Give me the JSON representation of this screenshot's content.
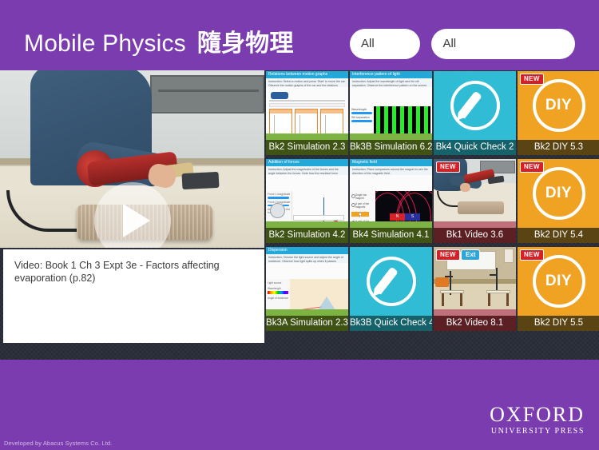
{
  "theme": {
    "brand_purple": "#7B3CAF",
    "canvas_dark": "#2b2f3a",
    "label_green": "#3f5314",
    "label_teal": "#15626b",
    "label_brown": "#5a4413",
    "label_maroon": "#5c2024",
    "badge_new_red": "#d81f26",
    "badge_ext_blue": "#2fa5d8",
    "tile_quickcheck": "#2fbcd4",
    "tile_diy": "#f0a322"
  },
  "header": {
    "title_en": "Mobile Physics",
    "title_zh": "隨身物理",
    "filters": [
      {
        "name": "book-filter",
        "value": "All"
      },
      {
        "name": "type-filter",
        "value": "All"
      }
    ]
  },
  "video_player": {
    "play_icon": "play-triangle-icon",
    "caption": "Video: Book 1 Ch 3 Expt 3e - Factors affecting evaporation (p.82)"
  },
  "tiles": [
    {
      "label": "Bk2 Simulation 2.3",
      "kind": "simulation",
      "label_color": "green",
      "badges": [],
      "sim_title": "Relations between motion graphs",
      "sim_instruction": "Instruction: Select a motion and press 'Start' to move the car. Observe the motion graphs of the car and the relations between the graphs."
    },
    {
      "label": "Bk3B Simulation 6.2",
      "kind": "simulation",
      "label_color": "green",
      "badges": [],
      "sim_title": "Interference pattern of light",
      "sim_instruction": "Instruction: Adjust the wavelength of light and the slit separation. Observe the interference pattern on the screen.",
      "controls": [
        "Wavelength",
        "Slit separation"
      ]
    },
    {
      "label": "Bk4 Quick Check 2",
      "kind": "quick-check",
      "label_color": "teal",
      "badges": [],
      "icon": "pencil-in-circle-icon"
    },
    {
      "label": "Bk2 DIY 5.3",
      "kind": "diy",
      "label_color": "brown",
      "badges": [
        "NEW"
      ],
      "icon": "diy-circle-icon",
      "icon_text": "DIY"
    },
    {
      "label": "Bk2 Simulation 4.2",
      "kind": "simulation",
      "label_color": "green",
      "badges": [],
      "sim_title": "Addition of forces",
      "sim_instruction": "Instruction: Adjust the magnitudes of the forces and the angle between the forces. Note how the resultant force varies.",
      "controls": [
        "Force 1 magnitude",
        "Force 2 magnitude",
        "Angle between the forces"
      ],
      "dropdown": "Resultant force"
    },
    {
      "label": "Bk4 Simulation 4.1",
      "kind": "simulation",
      "label_color": "green",
      "badges": [],
      "sim_title": "Magnetic field",
      "sim_instruction": "Instruction: Place compasses around the magnet to see the direction of the magnetic field.",
      "magnet_poles": [
        "N",
        "S"
      ]
    },
    {
      "label": "Bk1 Video 3.6",
      "kind": "video",
      "label_color": "maroon",
      "badges": [
        "NEW"
      ]
    },
    {
      "label": "Bk2 DIY 5.4",
      "kind": "diy",
      "label_color": "brown",
      "badges": [
        "NEW"
      ],
      "icon": "diy-circle-icon",
      "icon_text": "DIY"
    },
    {
      "label": "Bk3A Simulation 2.3",
      "kind": "simulation",
      "label_color": "green",
      "badges": [],
      "sim_title": "Dispersion",
      "sim_instruction": "Instruction: Choose the light source and adjust the angle of incidence. Observe how light splits up when it passes through the prism.",
      "controls": [
        "Light source",
        "Wavelength",
        "Angle of incidence"
      ]
    },
    {
      "label": "Bk3B Quick Check 4",
      "kind": "quick-check",
      "label_color": "teal",
      "badges": [],
      "icon": "pencil-in-circle-icon"
    },
    {
      "label": "Bk2 Video 8.1",
      "kind": "video",
      "label_color": "maroon",
      "badges": [
        "NEW",
        "Ext"
      ]
    },
    {
      "label": "Bk2 DIY 5.5",
      "kind": "diy",
      "label_color": "brown",
      "badges": [
        "NEW"
      ],
      "icon": "diy-circle-icon",
      "icon_text": "DIY"
    }
  ],
  "footer": {
    "publisher_line1": "OXFORD",
    "publisher_line2": "UNIVERSITY PRESS",
    "credit": "Developed by Abacus Systems Co. Ltd."
  }
}
